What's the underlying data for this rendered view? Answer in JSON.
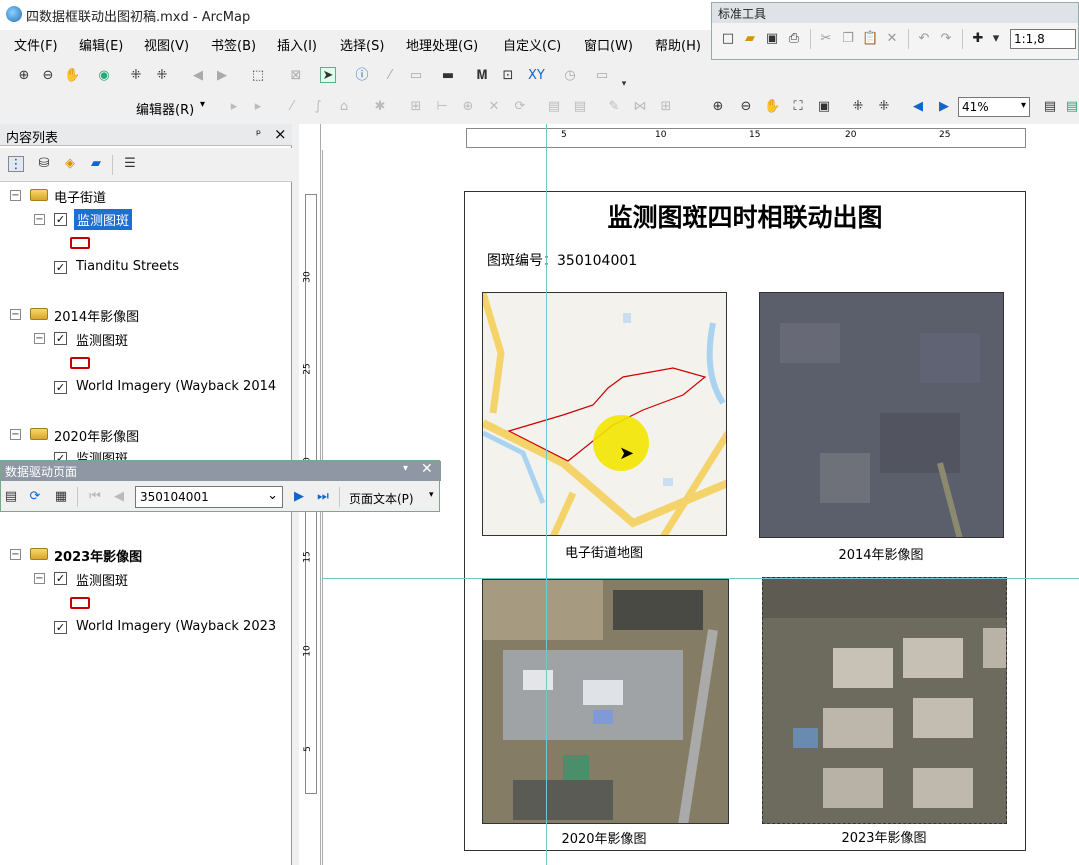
{
  "app": {
    "title": "四数据框联动出图初稿.mxd - ArcMap"
  },
  "menu": [
    "文件(F)",
    "编辑(E)",
    "视图(V)",
    "书签(B)",
    "插入(I)",
    "选择(S)",
    "地理处理(G)",
    "自定义(C)",
    "窗口(W)",
    "帮助(H)"
  ],
  "std_toolbar": {
    "title": "标准工具",
    "scale": "1:1,8"
  },
  "editor": {
    "label": "编辑器(R)"
  },
  "zoom": {
    "value": "41%"
  },
  "toc": {
    "title": "内容列表",
    "pin": "ᵖ",
    "close": "×",
    "groups": [
      {
        "name": "电子街道",
        "sublayers": [
          {
            "name": "监测图斑",
            "selected": true
          },
          {
            "name": "Tianditu Streets"
          }
        ]
      },
      {
        "name": "2014年影像图",
        "sublayers": [
          {
            "name": "监测图斑"
          },
          {
            "name": "World Imagery (Wayback 2014"
          }
        ]
      },
      {
        "name": "2020年影像图",
        "sublayers": [
          {
            "name": "监测图斑"
          }
        ]
      },
      {
        "name": "2023年影像图",
        "sublayers": [
          {
            "name": "监测图斑"
          },
          {
            "name": "World Imagery (Wayback 2023"
          }
        ]
      }
    ]
  },
  "ddp": {
    "title": "数据驱动页面",
    "page_value": "350104001",
    "page_text_label": "页面文本(P)"
  },
  "ruler": {
    "h_ticks": [
      "5",
      "10",
      "15",
      "20",
      "25"
    ],
    "v_ticks": [
      "30",
      "25",
      "20",
      "15",
      "10",
      "5"
    ]
  },
  "layout": {
    "title": "监测图斑四时相联动出图",
    "id_label": "图斑编号：350104001",
    "captions": [
      "电子街道地图",
      "2014年影像图",
      "2020年影像图",
      "2023年影像图"
    ]
  }
}
